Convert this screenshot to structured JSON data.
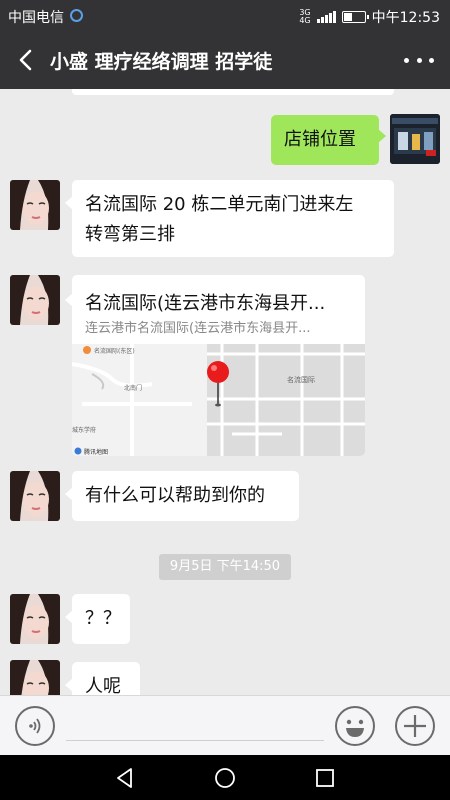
{
  "status": {
    "carrier": "中国电信",
    "network_top": "3G",
    "network_bottom": "4G",
    "time": "中午12:53"
  },
  "header": {
    "title": "小盛  理疗经络调理  招学徒",
    "back_icon": "back-arrow-icon",
    "more_icon": "more-dots-icon"
  },
  "messages": [
    {
      "from": "me",
      "text": "店铺位置"
    },
    {
      "from": "other",
      "text_line1": "名流国际 20 栋二单元南门进来左",
      "text_line2": "转弯第三排"
    },
    {
      "from": "other",
      "type": "location",
      "title": "名流国际(连云港市东海县开...",
      "subtitle": "连云港市名流国际(连云港市东海县开...",
      "map_labels": {
        "poi_top_left": "名流国际(东区)",
        "gate": "北南门",
        "poi_right": "名流国际",
        "poi_bottom_left": "城东学府",
        "brand": "腾讯地图"
      }
    },
    {
      "from": "other",
      "text": "有什么可以帮助到你的"
    },
    {
      "type": "timestamp",
      "text": "9月5日 下午14:50"
    },
    {
      "from": "other",
      "text": "？？"
    },
    {
      "from": "other",
      "text": "人呢"
    }
  ],
  "input": {
    "voice_icon": "voice-icon",
    "emoji_icon": "emoji-icon",
    "plus_icon": "plus-icon"
  },
  "colors": {
    "header_bg": "#333335",
    "chat_bg": "#ebebeb",
    "my_bubble": "#9fe65a",
    "their_bubble": "#ffffff"
  }
}
